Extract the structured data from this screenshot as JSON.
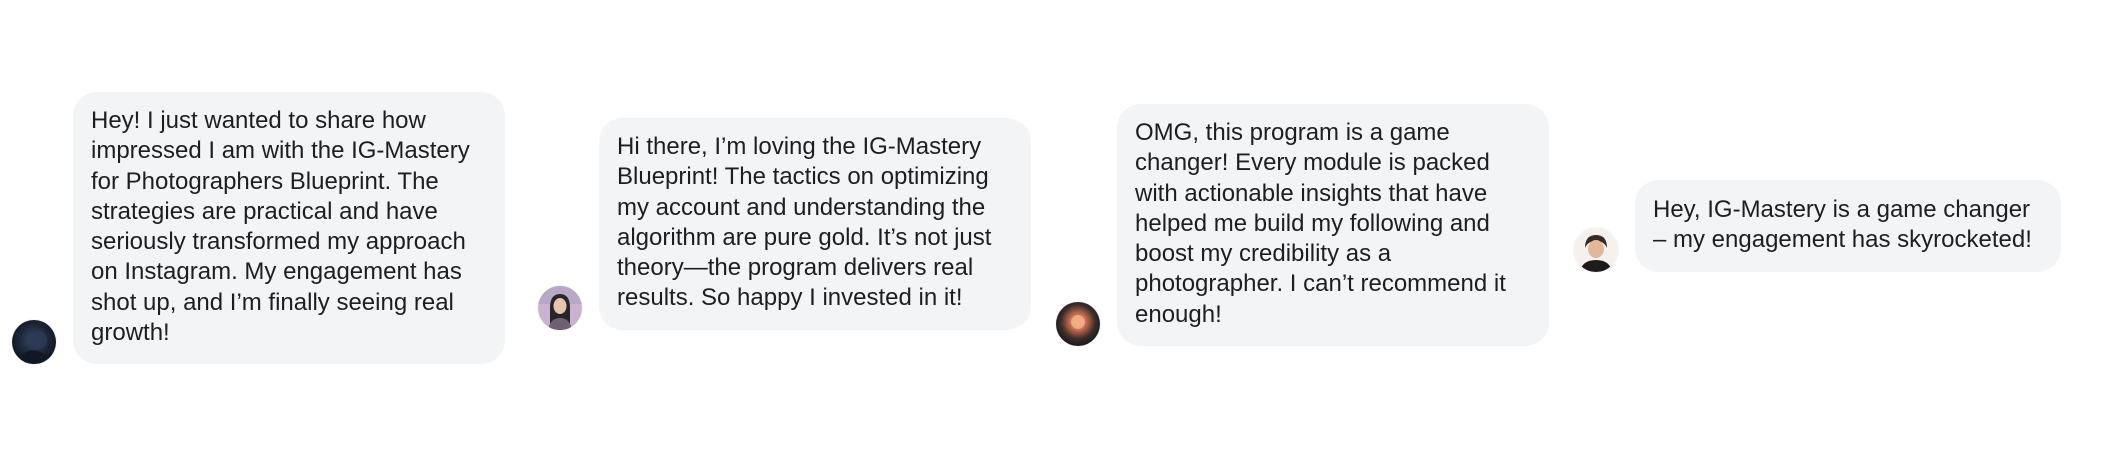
{
  "messages": [
    {
      "avatar_icon": "avatar-dark-photo-icon",
      "text": "Hey! I just wanted to share how impressed I am with the IG-Mastery for Photographers Blueprint. The strategies are practical and have seriously transformed my approach on Instagram. My engagement has shot up, and I’m finally seeing real growth!"
    },
    {
      "avatar_icon": "avatar-woman-portrait-icon",
      "text": "Hi there, I’m loving the IG-Mastery Blueprint! The tactics on optimizing my account and understanding the algorithm are pure gold. It’s not just theory—the program delivers real results. So happy I invested in it!"
    },
    {
      "avatar_icon": "avatar-sunset-orb-icon",
      "text": "OMG, this program is a game changer! Every module is packed with actionable insights that have helped me build my following and boost my credibility as a photographer. I can’t recommend it enough!"
    },
    {
      "avatar_icon": "avatar-man-portrait-icon",
      "text": "Hey, IG-Mastery is a game changer – my engagement has skyrocketed!"
    }
  ],
  "colors": {
    "bubble_background": "#f3f4f6",
    "text": "#1c1e21",
    "page_background": "#ffffff"
  }
}
